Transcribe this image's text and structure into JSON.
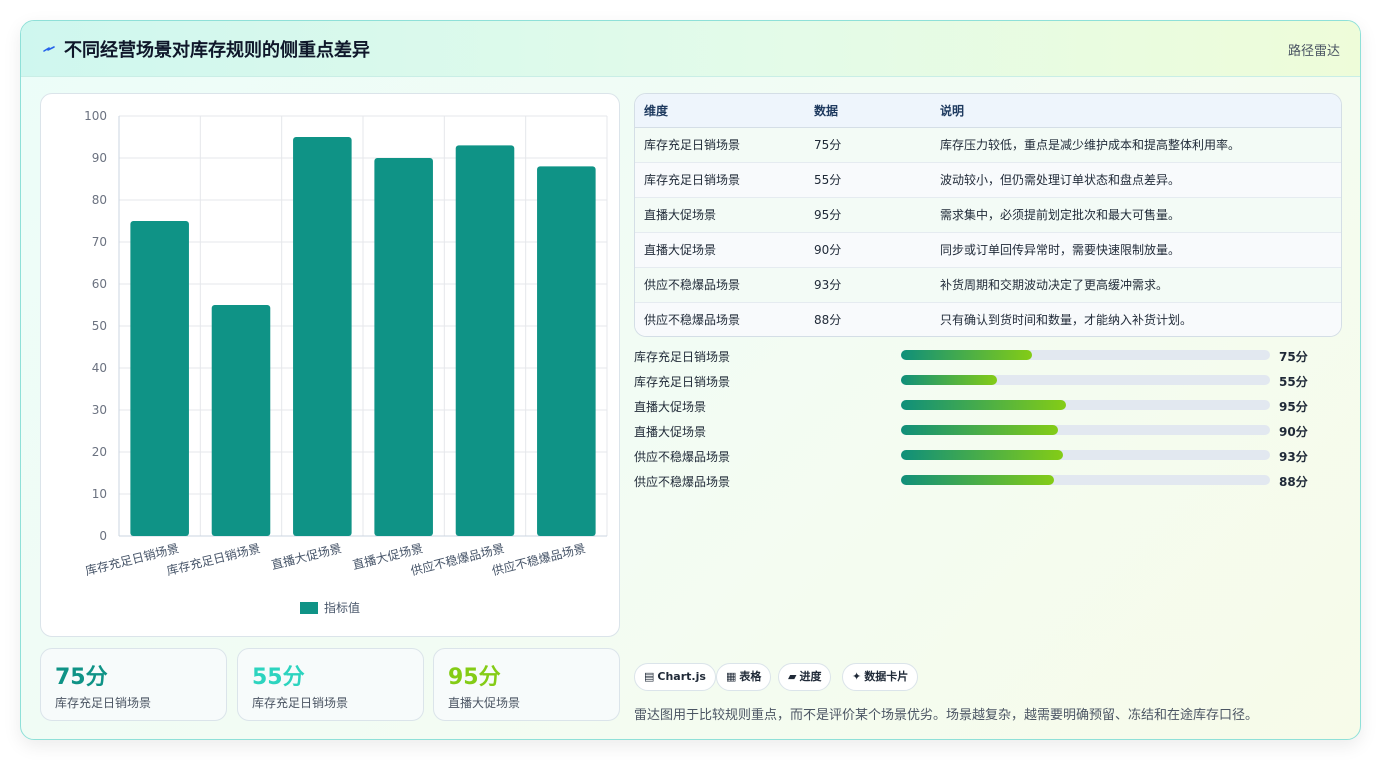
{
  "header": {
    "title": "不同经营场景对库存规则的侧重点差异",
    "link": "路径雷达"
  },
  "colors": {
    "bar": "#0f9386",
    "accent_teal": "#0f9386",
    "accent_cyan": "#2dd4bf",
    "accent_lime": "#84cc16"
  },
  "chart_data": {
    "type": "bar",
    "categories": [
      "库存充足日销场景",
      "库存充足日销场景",
      "直播大促场景",
      "直播大促场景",
      "供应不稳爆品场景",
      "供应不稳爆品场景"
    ],
    "series": [
      {
        "name": "指标值",
        "values": [
          75,
          55,
          95,
          90,
          93,
          88
        ]
      }
    ],
    "ylim": [
      0,
      100
    ],
    "yticks": [
      "0",
      "10",
      "20",
      "30",
      "40",
      "50",
      "60",
      "70",
      "80",
      "90",
      "100"
    ],
    "grid": true,
    "legend": "bottom"
  },
  "stats": [
    {
      "value": "75分",
      "label": "库存充足日销场景",
      "color": "#0f9386"
    },
    {
      "value": "55分",
      "label": "库存充足日销场景",
      "color": "#2dd4bf"
    },
    {
      "value": "95分",
      "label": "直播大促场景",
      "color": "#84cc16"
    }
  ],
  "table": {
    "headers": [
      "维度",
      "数据",
      "说明"
    ],
    "rows": [
      [
        "库存充足日销场景",
        "75分",
        "库存压力较低，重点是减少维护成本和提高整体利用率。"
      ],
      [
        "库存充足日销场景",
        "55分",
        "波动较小，但仍需处理订单状态和盘点差异。"
      ],
      [
        "直播大促场景",
        "95分",
        "需求集中，必须提前划定批次和最大可售量。"
      ],
      [
        "直播大促场景",
        "90分",
        "同步或订单回传异常时，需要快速限制放量。"
      ],
      [
        "供应不稳爆品场景",
        "93分",
        "补货周期和交期波动决定了更高缓冲需求。"
      ],
      [
        "供应不稳爆品场景",
        "88分",
        "只有确认到货时间和数量，才能纳入补货计划。"
      ]
    ]
  },
  "progress": [
    {
      "label": "库存充足日销场景",
      "value": "75分",
      "fraction": 0.355
    },
    {
      "label": "库存充足日销场景",
      "value": "55分",
      "fraction": 0.26
    },
    {
      "label": "直播大促场景",
      "value": "95分",
      "fraction": 0.447
    },
    {
      "label": "直播大促场景",
      "value": "90分",
      "fraction": 0.425
    },
    {
      "label": "供应不稳爆品场景",
      "value": "93分",
      "fraction": 0.438
    },
    {
      "label": "供应不稳爆品场景",
      "value": "88分",
      "fraction": 0.414
    }
  ],
  "chips": [
    {
      "icon": "▤",
      "label": "Chart.js"
    },
    {
      "icon": "▦",
      "label": "表格"
    },
    {
      "icon": "▰",
      "label": "进度"
    },
    {
      "icon": "✦",
      "label": "数据卡片"
    }
  ],
  "note": "雷达图用于比较规则重点，而不是评价某个场景优劣。场景越复杂，越需要明确预留、冻结和在途库存口径。"
}
